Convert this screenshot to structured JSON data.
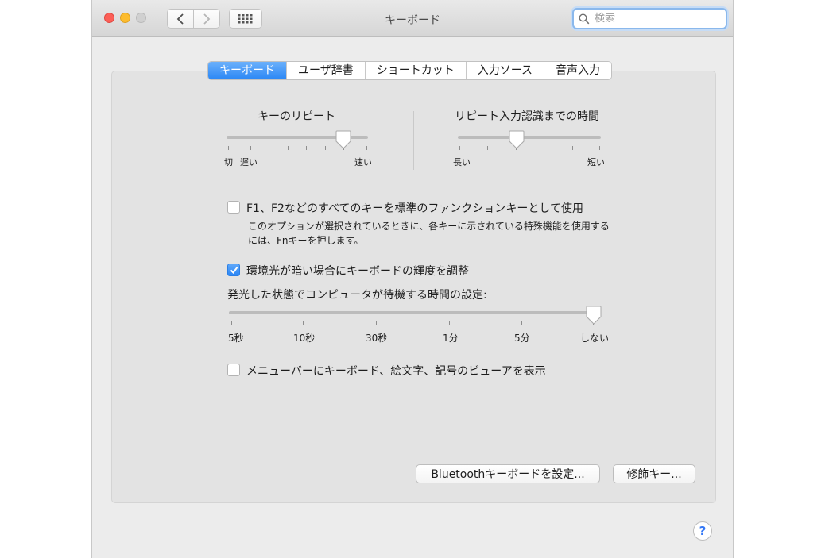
{
  "window": {
    "title": "キーボード"
  },
  "search": {
    "placeholder": "検索"
  },
  "tabs": [
    {
      "label": "キーボード",
      "active": true
    },
    {
      "label": "ユーザ辞書",
      "active": false
    },
    {
      "label": "ショートカット",
      "active": false
    },
    {
      "label": "入力ソース",
      "active": false
    },
    {
      "label": "音声入力",
      "active": false
    }
  ],
  "key_repeat": {
    "title": "キーのリピート",
    "label_off": "切",
    "label_slow": "遅い",
    "label_fast": "速い",
    "level": 0.82
  },
  "delay_until_repeat": {
    "title": "リピート入力認識までの時間",
    "label_long": "長い",
    "label_short": "短い",
    "level": 0.4
  },
  "fn_keys": {
    "checked": false,
    "label": "F1、F2などのすべてのキーを標準のファンクションキーとして使用",
    "description_line1": "このオプションが選択されているときに、各キーに示されている特殊機能を使用する",
    "description_line2": "には、Fnキーを押します。"
  },
  "adjust_brightness": {
    "checked": true,
    "label": "環境光が暗い場合にキーボードの輝度を調整"
  },
  "backlight_timeout": {
    "title": "発光した状態でコンピュータが待機する時間の設定:",
    "ticks": [
      "5秒",
      "10秒",
      "30秒",
      "1分",
      "5分",
      "しない"
    ],
    "selected": "しない"
  },
  "show_viewer": {
    "checked": false,
    "label": "メニューバーにキーボード、絵文字、記号のビューアを表示"
  },
  "buttons": {
    "bluetooth": "Bluetoothキーボードを設定...",
    "modifier": "修飾キー..."
  },
  "help": {
    "label": "?"
  },
  "colors": {
    "accent": "#2b87f5",
    "window_bg": "#ececec",
    "panel_bg": "#e3e3e3"
  },
  "icons": {
    "back": "chevron-left-icon",
    "forward": "chevron-right-icon",
    "grid": "grid-icon",
    "search": "search-icon",
    "check": "checkmark-icon"
  }
}
